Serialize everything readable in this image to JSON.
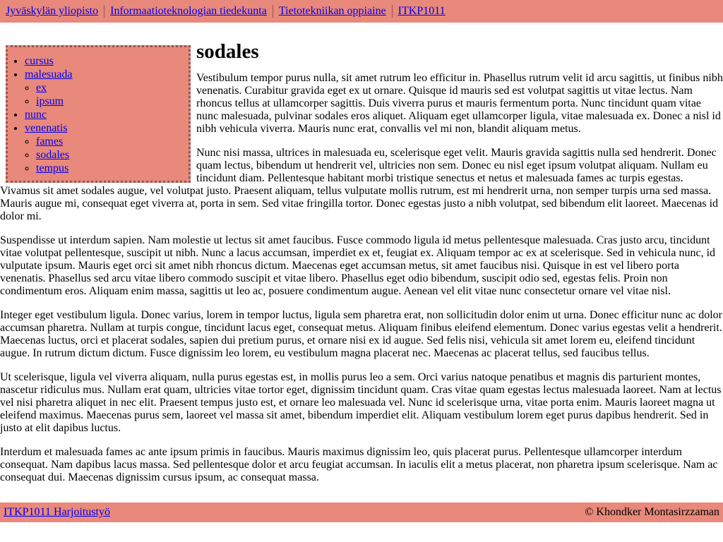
{
  "breadcrumb": [
    {
      "label": "Jyväskylän yliopisto"
    },
    {
      "label": "Informaatioteknologian tiedekunta"
    },
    {
      "label": "Tietotekniikan oppiaine"
    },
    {
      "label": "ITKP1011"
    }
  ],
  "nav": {
    "items": [
      {
        "label": "cursus"
      },
      {
        "label": "malesuada",
        "children": [
          {
            "label": "ex"
          },
          {
            "label": "ipsum"
          }
        ]
      },
      {
        "label": "nunc"
      },
      {
        "label": "venenatis",
        "children": [
          {
            "label": "fames"
          },
          {
            "label": "sodales"
          },
          {
            "label": "tempus"
          }
        ]
      }
    ]
  },
  "main": {
    "title": "sodales",
    "paragraphs": [
      "Vestibulum tempor purus nulla, sit amet rutrum leo efficitur in. Phasellus rutrum velit id arcu sagittis, ut finibus nibh venenatis. Curabitur gravida eget ex ut ornare. Quisque id mauris sed est volutpat sagittis ut vitae lectus. Nam rhoncus tellus at ullamcorper sagittis. Duis viverra purus et mauris fermentum porta. Nunc tincidunt quam vitae nunc malesuada, pulvinar sodales eros aliquet. Aliquam eget ullamcorper ligula, vitae malesuada ex. Donec a nisl id nibh vehicula viverra. Mauris nunc erat, convallis vel mi non, blandit aliquam metus.",
      "Nunc nisi massa, ultrices in malesuada eu, scelerisque eget velit. Mauris gravida sagittis nulla sed hendrerit. Donec quam lectus, bibendum ut hendrerit vel, ultricies non sem. Donec eu nisl eget ipsum volutpat aliquam. Nullam eu tincidunt diam. Pellentesque habitant morbi tristique senectus et netus et malesuada fames ac turpis egestas. Vivamus sit amet sodales augue, vel volutpat justo. Praesent aliquam, tellus vulputate mollis rutrum, est mi hendrerit urna, non semper turpis urna sed massa. Mauris augue mi, consequat eget viverra at, porta in sem. Sed vitae fringilla tortor. Donec egestas justo a nibh volutpat, sed bibendum elit laoreet. Maecenas id dolor mi.",
      "Suspendisse ut interdum sapien. Nam molestie ut lectus sit amet faucibus. Fusce commodo ligula id metus pellentesque malesuada. Cras justo arcu, tincidunt vitae volutpat pellentesque, suscipit ut nibh. Nunc a lacus accumsan, imperdiet ex et, feugiat ex. Aliquam tempor ac ex at scelerisque. Sed in vehicula nunc, id vulputate ipsum. Mauris eget orci sit amet nibh rhoncus dictum. Maecenas eget accumsan metus, sit amet faucibus nisi. Quisque in est vel libero porta venenatis. Phasellus sed arcu vitae libero commodo suscipit et vitae libero. Phasellus eget odio bibendum, suscipit odio sed, egestas felis. Proin non condimentum eros. Aliquam enim massa, sagittis ut leo ac, posuere condimentum augue. Aenean vel elit vitae nunc consectetur ornare vel vitae nisl.",
      "Integer eget vestibulum ligula. Donec varius, lorem in tempor luctus, ligula sem pharetra erat, non sollicitudin dolor enim ut urna. Donec efficitur nunc ac dolor accumsan pharetra. Nullam at turpis congue, tincidunt lacus eget, consequat metus. Aliquam finibus eleifend elementum. Donec varius egestas velit a hendrerit. Maecenas luctus, orci et placerat sodales, sapien dui pretium purus, et ornare nisi ex id augue. Sed felis nisi, vehicula sit amet lorem eu, eleifend tincidunt augue. In rutrum dictum dictum. Fusce dignissim leo lorem, eu vestibulum magna placerat nec. Maecenas ac placerat tellus, sed faucibus tellus.",
      "Ut scelerisque, ligula vel viverra aliquam, nulla purus egestas est, in mollis purus leo a sem. Orci varius natoque penatibus et magnis dis parturient montes, nascetur ridiculus mus. Nullam erat quam, ultricies vitae tortor eget, dignissim tincidunt quam. Cras vitae quam egestas lectus malesuada laoreet. Nam at lectus vel nisi pharetra aliquet in nec elit. Praesent tempus justo est, et ornare leo malesuada vel. Nunc id scelerisque urna, vitae porta enim. Mauris laoreet magna ut eleifend maximus. Maecenas purus sem, laoreet vel massa sit amet, bibendum imperdiet elit. Aliquam vestibulum lorem eget purus dapibus hendrerit. Sed in justo at elit dapibus luctus.",
      "Interdum et malesuada fames ac ante ipsum primis in faucibus. Mauris maximus dignissim leo, quis placerat purus. Pellentesque ullamcorper interdum consequat. Nam dapibus lacus massa. Sed pellentesque dolor et arcu feugiat accumsan. In iaculis elit a metus placerat, non pharetra ipsum scelerisque. Nam ac consequat dui. Maecenas dignissim cursus ipsum, ac consequat massa."
    ]
  },
  "footer": {
    "link_label": "ITKP1011 Harjoitustyö",
    "copyright": "©  Khondker Montasirzzaman"
  },
  "colors": {
    "bar_background": "#e8897b",
    "link": "#0000ee"
  }
}
